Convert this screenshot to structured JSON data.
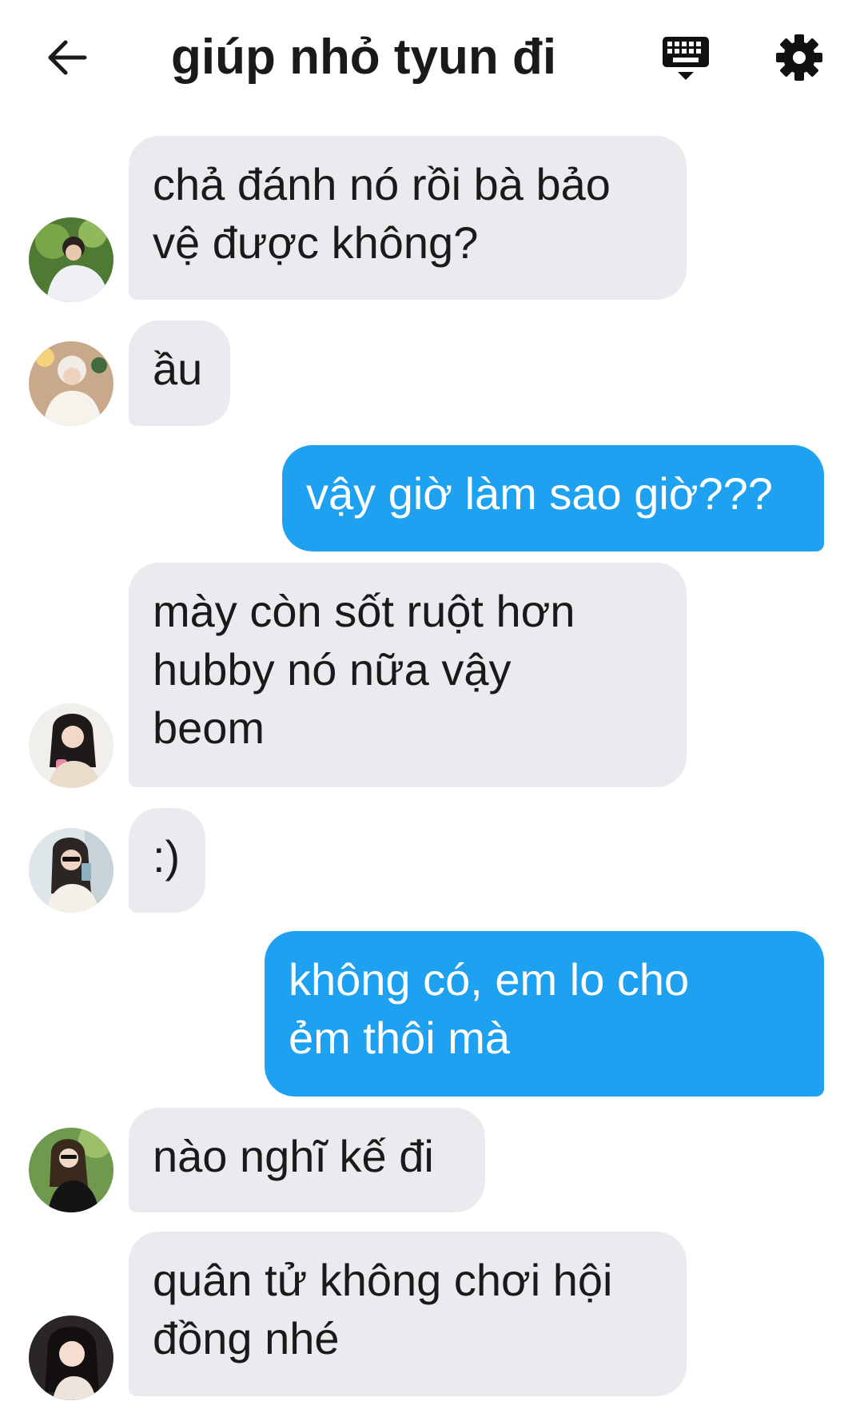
{
  "header": {
    "title": "giúp nhỏ tyun đi",
    "back_icon": "arrow-left-icon",
    "keyboard_icon": "keyboard-icon",
    "settings_icon": "gear-icon"
  },
  "messages": [
    {
      "direction": "in",
      "text": "chả đánh nó rồi bà bảo\nvệ được không?"
    },
    {
      "direction": "in",
      "text": "ầu"
    },
    {
      "direction": "out",
      "text": "vậy giờ làm sao giờ???"
    },
    {
      "direction": "in",
      "text": "mày còn sốt ruột hơn\nhubby nó nữa vậy\nbeom"
    },
    {
      "direction": "in",
      "text": ":)"
    },
    {
      "direction": "out",
      "text": "không có, em lo cho\nẻm thôi mà"
    },
    {
      "direction": "in",
      "text": "nào nghĩ kế đi"
    },
    {
      "direction": "in",
      "text": "quân tử không chơi hội\nđồng nhé"
    }
  ],
  "colors": {
    "incoming_bubble": "#e9ebee",
    "outgoing_bubble": "#1fa1f1",
    "outgoing_text": "#ffffff"
  }
}
